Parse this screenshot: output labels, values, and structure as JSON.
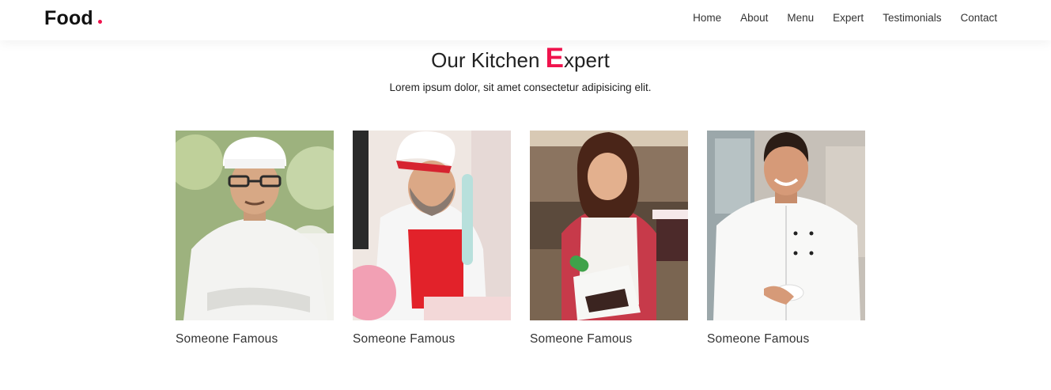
{
  "brand": {
    "name": "Food"
  },
  "nav": {
    "items": [
      {
        "label": "Home"
      },
      {
        "label": "About"
      },
      {
        "label": "Menu"
      },
      {
        "label": "Expert"
      },
      {
        "label": "Testimonials"
      },
      {
        "label": "Contact"
      }
    ]
  },
  "colors": {
    "accent": "#f0134d"
  },
  "expert_section": {
    "title_before": "Our Kitchen ",
    "title_accent_letter": "E",
    "title_after": "xpert",
    "subtitle": "Lorem ipsum dolor, sit amet consectetur adipisicing elit.",
    "experts": [
      {
        "name": "Someone Famous"
      },
      {
        "name": "Someone Famous"
      },
      {
        "name": "Someone Famous"
      },
      {
        "name": "Someone Famous"
      }
    ]
  }
}
